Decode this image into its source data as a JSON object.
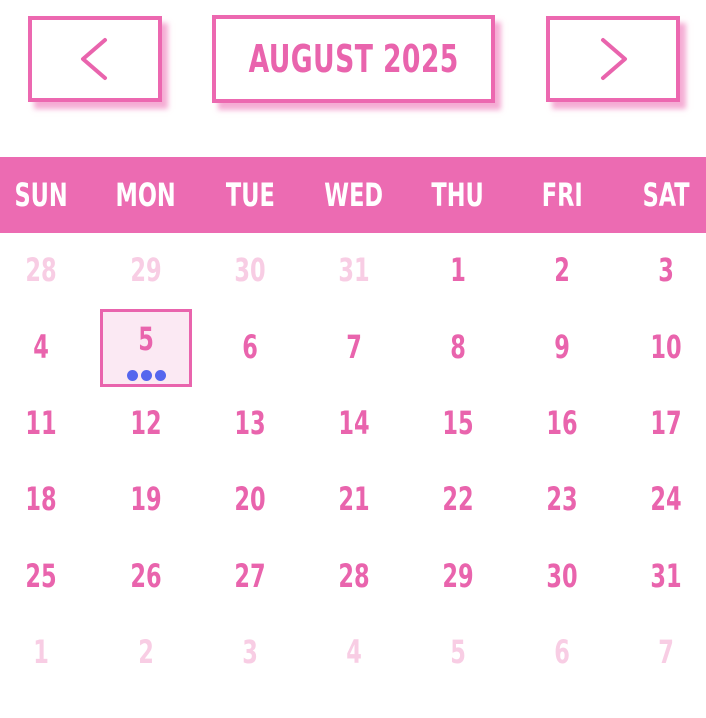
{
  "header": {
    "month_title": "AUGUST 2025",
    "prev_icon": "chevron-left-icon",
    "next_icon": "chevron-right-icon"
  },
  "weekdays": [
    "SUN",
    "MON",
    "TUE",
    "WED",
    "THU",
    "FRI",
    "SAT"
  ],
  "weeks": [
    [
      {
        "d": "28",
        "muted": true
      },
      {
        "d": "29",
        "muted": true
      },
      {
        "d": "30",
        "muted": true
      },
      {
        "d": "31",
        "muted": true
      },
      {
        "d": "1"
      },
      {
        "d": "2"
      },
      {
        "d": "3"
      }
    ],
    [
      {
        "d": "4"
      },
      {
        "d": "5",
        "selected": true,
        "events": 3
      },
      {
        "d": "6"
      },
      {
        "d": "7"
      },
      {
        "d": "8"
      },
      {
        "d": "9"
      },
      {
        "d": "10"
      }
    ],
    [
      {
        "d": "11"
      },
      {
        "d": "12"
      },
      {
        "d": "13"
      },
      {
        "d": "14"
      },
      {
        "d": "15"
      },
      {
        "d": "16"
      },
      {
        "d": "17"
      }
    ],
    [
      {
        "d": "18"
      },
      {
        "d": "19"
      },
      {
        "d": "20"
      },
      {
        "d": "21"
      },
      {
        "d": "22"
      },
      {
        "d": "23"
      },
      {
        "d": "24"
      }
    ],
    [
      {
        "d": "25"
      },
      {
        "d": "26"
      },
      {
        "d": "27"
      },
      {
        "d": "28"
      },
      {
        "d": "29"
      },
      {
        "d": "30"
      },
      {
        "d": "31"
      }
    ],
    [
      {
        "d": "1",
        "muted": true
      },
      {
        "d": "2",
        "muted": true
      },
      {
        "d": "3",
        "muted": true
      },
      {
        "d": "4",
        "muted": true
      },
      {
        "d": "5",
        "muted": true
      },
      {
        "d": "6",
        "muted": true
      },
      {
        "d": "7",
        "muted": true
      }
    ]
  ],
  "colors": {
    "accent": "#ec6bb2",
    "text": "#e964ad",
    "muted_text": "#f8cde4",
    "selected_bg": "#fbe9f3",
    "event_dot": "#5566ee"
  }
}
